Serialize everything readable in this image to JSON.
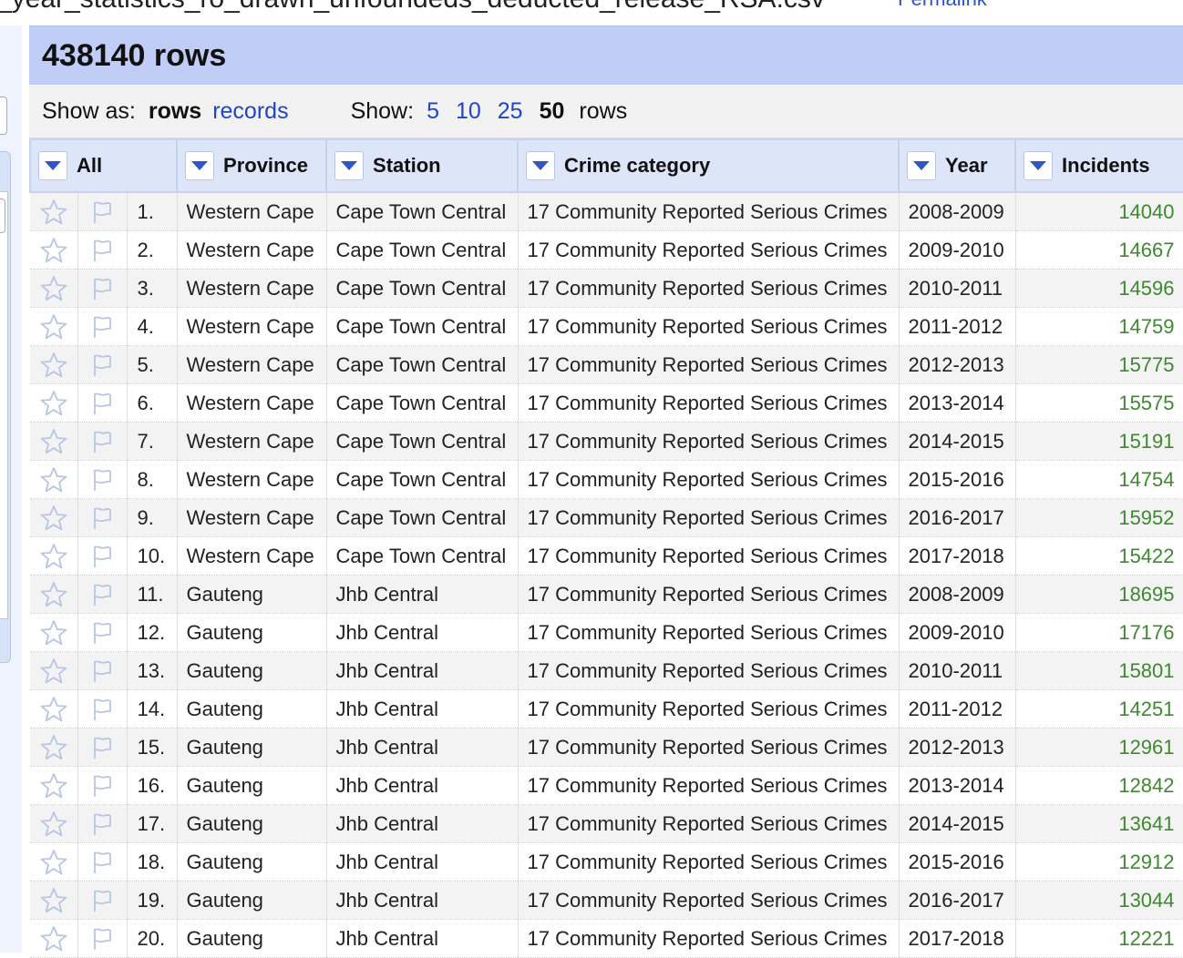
{
  "window": {
    "filename": "_year_statistics_ro_drawn_unfoundeds_deducted_release_RSA.csv",
    "permalink": "Permalink"
  },
  "summary": {
    "row_count_label": "438140 rows"
  },
  "controls": {
    "show_as_label": "Show as:",
    "mode_current": "rows",
    "mode_other": "records",
    "show_label": "Show:",
    "page_sizes": [
      "5",
      "10",
      "25"
    ],
    "page_size_current": "50",
    "rows_suffix": "rows"
  },
  "columns": {
    "all": "All",
    "province": "Province",
    "station": "Station",
    "crime_category": "Crime category",
    "year": "Year",
    "incidents": "Incidents"
  },
  "icons": {
    "star": "star-icon",
    "flag": "flag-icon",
    "dropdown": "chevron-down-icon"
  },
  "colors": {
    "header_band": "#bfcdf7",
    "column_header": "#dde5f8",
    "link": "#1f46c2",
    "number": "#3c8a2e"
  },
  "rows": [
    {
      "idx": "1.",
      "province": "Western Cape",
      "station": "Cape Town Central",
      "category": "17 Community Reported Serious Crimes",
      "year": "2008-2009",
      "incidents": "14040"
    },
    {
      "idx": "2.",
      "province": "Western Cape",
      "station": "Cape Town Central",
      "category": "17 Community Reported Serious Crimes",
      "year": "2009-2010",
      "incidents": "14667"
    },
    {
      "idx": "3.",
      "province": "Western Cape",
      "station": "Cape Town Central",
      "category": "17 Community Reported Serious Crimes",
      "year": "2010-2011",
      "incidents": "14596"
    },
    {
      "idx": "4.",
      "province": "Western Cape",
      "station": "Cape Town Central",
      "category": "17 Community Reported Serious Crimes",
      "year": "2011-2012",
      "incidents": "14759"
    },
    {
      "idx": "5.",
      "province": "Western Cape",
      "station": "Cape Town Central",
      "category": "17 Community Reported Serious Crimes",
      "year": "2012-2013",
      "incidents": "15775"
    },
    {
      "idx": "6.",
      "province": "Western Cape",
      "station": "Cape Town Central",
      "category": "17 Community Reported Serious Crimes",
      "year": "2013-2014",
      "incidents": "15575"
    },
    {
      "idx": "7.",
      "province": "Western Cape",
      "station": "Cape Town Central",
      "category": "17 Community Reported Serious Crimes",
      "year": "2014-2015",
      "incidents": "15191"
    },
    {
      "idx": "8.",
      "province": "Western Cape",
      "station": "Cape Town Central",
      "category": "17 Community Reported Serious Crimes",
      "year": "2015-2016",
      "incidents": "14754"
    },
    {
      "idx": "9.",
      "province": "Western Cape",
      "station": "Cape Town Central",
      "category": "17 Community Reported Serious Crimes",
      "year": "2016-2017",
      "incidents": "15952"
    },
    {
      "idx": "10.",
      "province": "Western Cape",
      "station": "Cape Town Central",
      "category": "17 Community Reported Serious Crimes",
      "year": "2017-2018",
      "incidents": "15422"
    },
    {
      "idx": "11.",
      "province": "Gauteng",
      "station": "Jhb Central",
      "category": "17 Community Reported Serious Crimes",
      "year": "2008-2009",
      "incidents": "18695"
    },
    {
      "idx": "12.",
      "province": "Gauteng",
      "station": "Jhb Central",
      "category": "17 Community Reported Serious Crimes",
      "year": "2009-2010",
      "incidents": "17176"
    },
    {
      "idx": "13.",
      "province": "Gauteng",
      "station": "Jhb Central",
      "category": "17 Community Reported Serious Crimes",
      "year": "2010-2011",
      "incidents": "15801"
    },
    {
      "idx": "14.",
      "province": "Gauteng",
      "station": "Jhb Central",
      "category": "17 Community Reported Serious Crimes",
      "year": "2011-2012",
      "incidents": "14251"
    },
    {
      "idx": "15.",
      "province": "Gauteng",
      "station": "Jhb Central",
      "category": "17 Community Reported Serious Crimes",
      "year": "2012-2013",
      "incidents": "12961"
    },
    {
      "idx": "16.",
      "province": "Gauteng",
      "station": "Jhb Central",
      "category": "17 Community Reported Serious Crimes",
      "year": "2013-2014",
      "incidents": "12842"
    },
    {
      "idx": "17.",
      "province": "Gauteng",
      "station": "Jhb Central",
      "category": "17 Community Reported Serious Crimes",
      "year": "2014-2015",
      "incidents": "13641"
    },
    {
      "idx": "18.",
      "province": "Gauteng",
      "station": "Jhb Central",
      "category": "17 Community Reported Serious Crimes",
      "year": "2015-2016",
      "incidents": "12912"
    },
    {
      "idx": "19.",
      "province": "Gauteng",
      "station": "Jhb Central",
      "category": "17 Community Reported Serious Crimes",
      "year": "2016-2017",
      "incidents": "13044"
    },
    {
      "idx": "20.",
      "province": "Gauteng",
      "station": "Jhb Central",
      "category": "17 Community Reported Serious Crimes",
      "year": "2017-2018",
      "incidents": "12221"
    }
  ]
}
